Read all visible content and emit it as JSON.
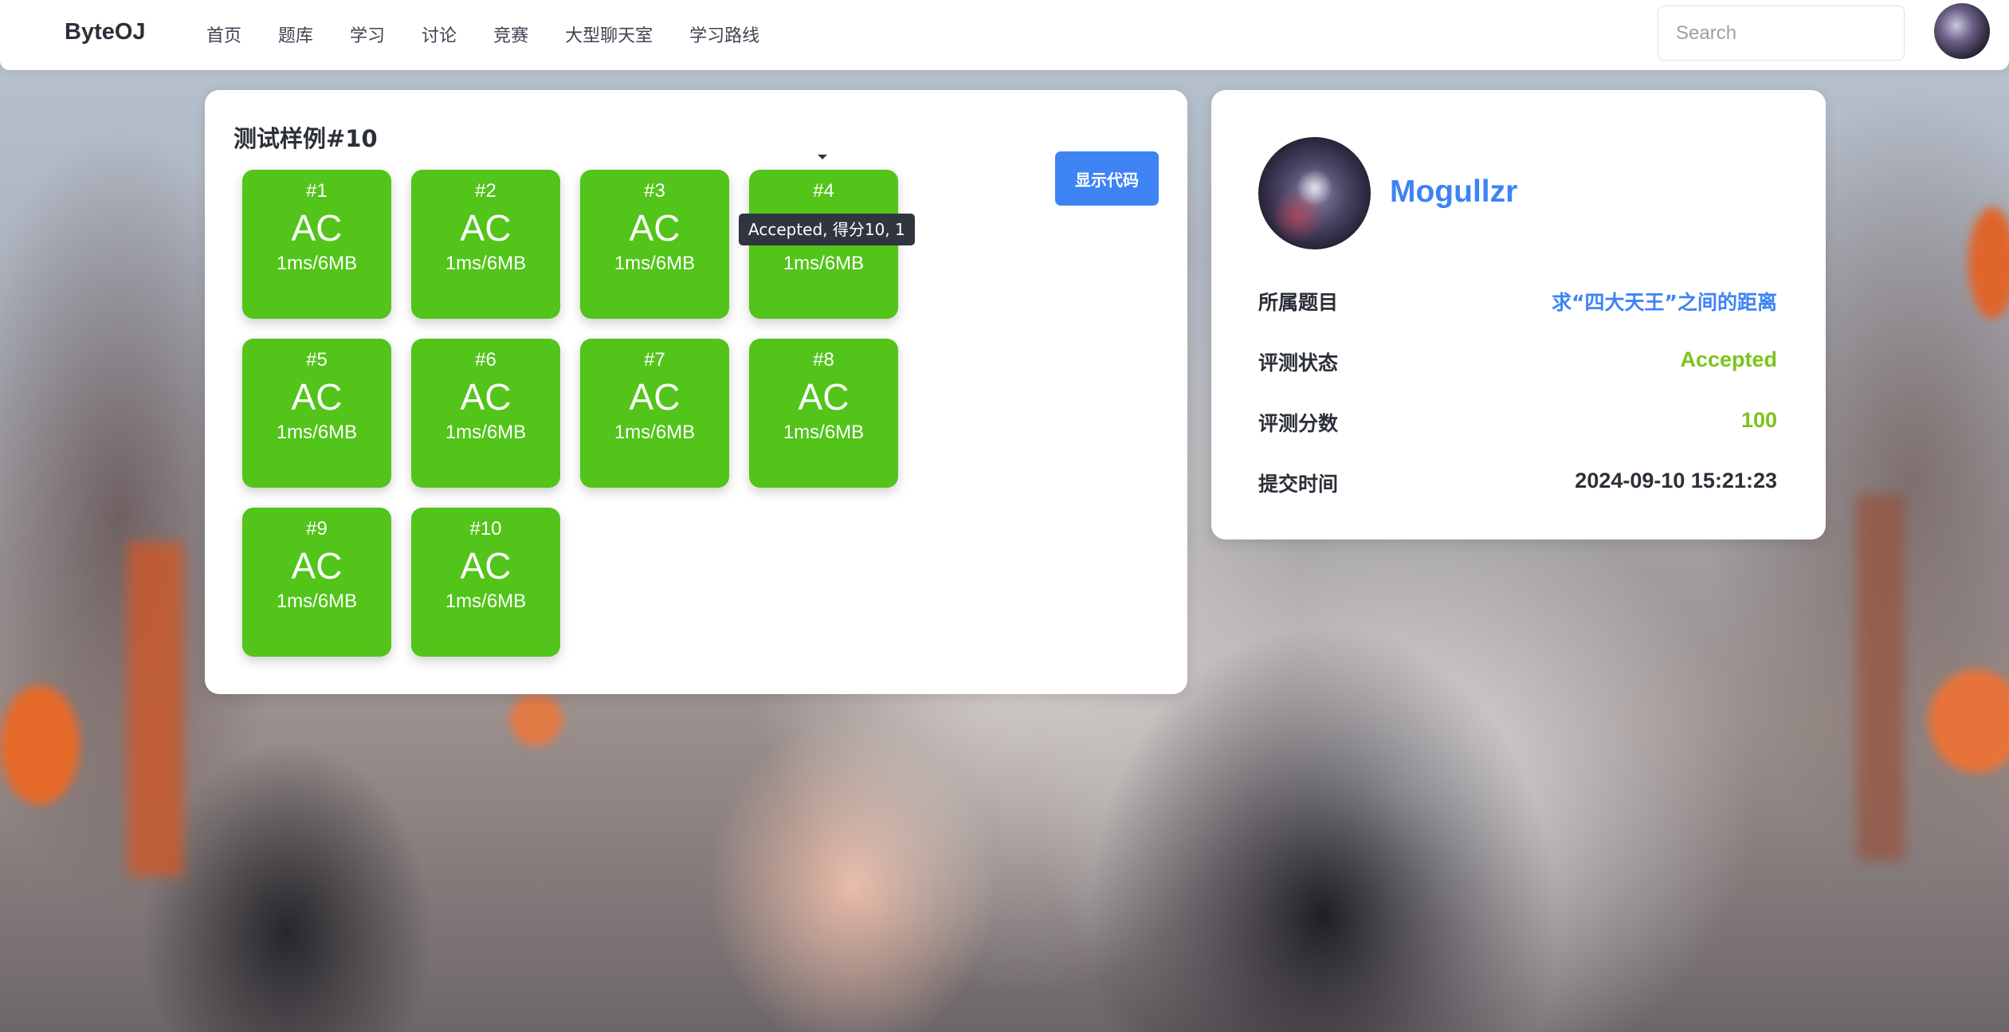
{
  "navbar": {
    "brand": "ByteOJ",
    "links": [
      "首页",
      "题库",
      "学习",
      "讨论",
      "竞赛",
      "大型聊天室",
      "学习路线"
    ],
    "search_placeholder": "Search"
  },
  "tests": {
    "title": "测试样例#10",
    "show_code_label": "显示代码",
    "tooltip": "Accepted, 得分10, 1",
    "case_color": "#52c41a",
    "cases": [
      {
        "no": "#1",
        "status": "AC",
        "usage": "1ms/6MB"
      },
      {
        "no": "#2",
        "status": "AC",
        "usage": "1ms/6MB"
      },
      {
        "no": "#3",
        "status": "AC",
        "usage": "1ms/6MB"
      },
      {
        "no": "#4",
        "status": "AC",
        "usage": "1ms/6MB"
      },
      {
        "no": "#5",
        "status": "AC",
        "usage": "1ms/6MB"
      },
      {
        "no": "#6",
        "status": "AC",
        "usage": "1ms/6MB"
      },
      {
        "no": "#7",
        "status": "AC",
        "usage": "1ms/6MB"
      },
      {
        "no": "#8",
        "status": "AC",
        "usage": "1ms/6MB"
      },
      {
        "no": "#9",
        "status": "AC",
        "usage": "1ms/6MB"
      },
      {
        "no": "#10",
        "status": "AC",
        "usage": "1ms/6MB"
      }
    ]
  },
  "submission": {
    "username": "Mogullzr",
    "problem_label": "所属题目",
    "problem_value": "求“四大天王”之间的距离",
    "status_label": "评测状态",
    "status_value": "Accepted",
    "score_label": "评测分数",
    "score_value": "100",
    "time_label": "提交时间",
    "time_value": "2024-09-10 15:21:23"
  },
  "colors": {
    "accent": "#3e83f4",
    "accepted": "#7cc41a"
  }
}
